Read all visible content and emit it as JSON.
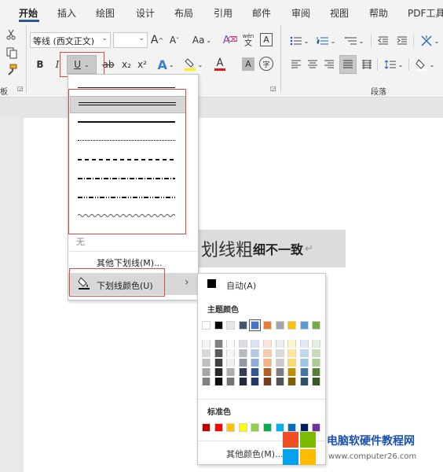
{
  "tabs": [
    "开始",
    "插入",
    "绘图",
    "设计",
    "布局",
    "引用",
    "邮件",
    "审阅",
    "视图",
    "帮助",
    "PDF工具"
  ],
  "font": {
    "name": "等线 (西文正文)",
    "size": "",
    "grow_label": "A",
    "shrink_label": "A",
    "case_label": "Aa",
    "pinyin_top": "wén",
    "pinyin_bottom": "文",
    "charborder_label": "A"
  },
  "format_buttons": {
    "bold": "B",
    "italic": "I",
    "underline": "U",
    "strike": "ab",
    "sub": "x₂",
    "sup": "x²",
    "effects": "A",
    "font_color": "A",
    "shading": "A",
    "enclose": "字"
  },
  "ribbon_groups": {
    "paragraph": "段落",
    "clipboard_stub": "板"
  },
  "document": {
    "big": "划线粗",
    "small": "细不一致",
    "mark": "↵"
  },
  "underline_menu": {
    "none_label": "无",
    "more_label": "其他下划线(M)...",
    "color_label": "下划线颜色(U)",
    "arrow": "›"
  },
  "color_menu": {
    "auto_label": "自动(A)",
    "theme_label": "主题颜色",
    "standard_label": "标准色",
    "more_label": "其他颜色(M)...",
    "theme_top": [
      "#ffffff",
      "#000000",
      "#e7e6e6",
      "#44546a",
      "#4472c4",
      "#ed7d31",
      "#a5a5a5",
      "#ffc000",
      "#5b9bd5",
      "#70ad47"
    ],
    "standard": [
      "#c00000",
      "#ff0000",
      "#ffc000",
      "#ffff00",
      "#92d050",
      "#00b050",
      "#00b0f0",
      "#0070c0",
      "#002060",
      "#7030a0"
    ]
  },
  "watermark": {
    "title": "电脑软硬件教程网",
    "url": "www.computer26.com"
  }
}
